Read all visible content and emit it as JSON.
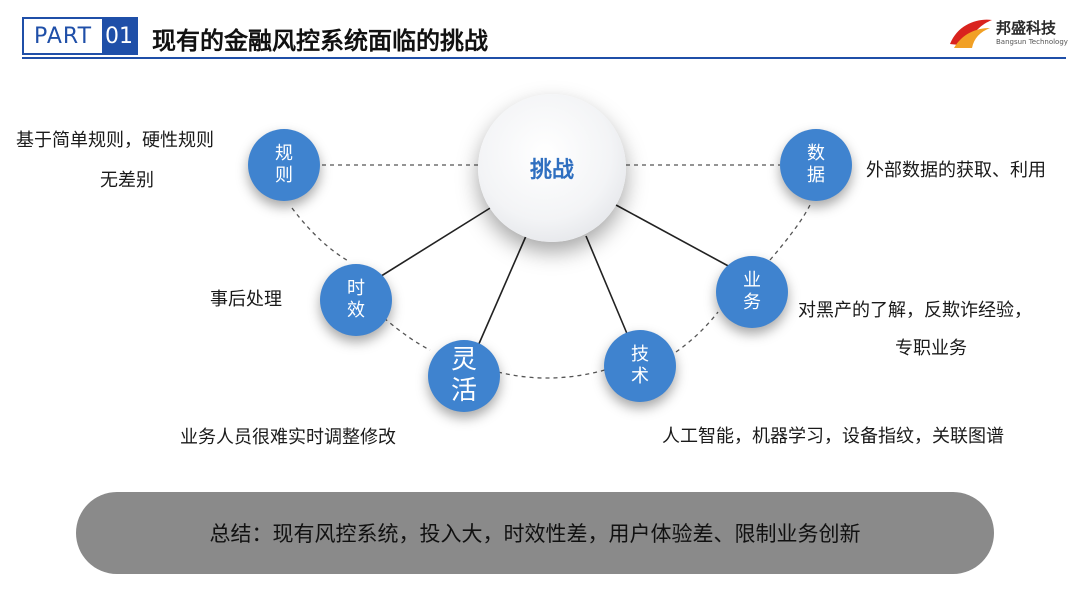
{
  "header": {
    "part_label": "PART",
    "part_number": "01",
    "title": "现有的金融风控系统面临的挑战",
    "logo_name": "邦盛科技",
    "logo_subtitle": "Bangsun Technology"
  },
  "diagram": {
    "center": "挑战",
    "nodes": {
      "rules": "规则",
      "timeliness": "时效",
      "flexible": "灵活",
      "tech": "技术",
      "business": "业务",
      "data": "数据"
    },
    "notes": {
      "rules_1": "基于简单规则，硬性规则",
      "rules_2": "无差别",
      "timeliness": "事后处理",
      "flexible": "业务人员很难实时调整修改",
      "tech": "人工智能，机器学习，设备指纹，关联图谱",
      "business_1": "对黑产的了解，反欺诈经验，",
      "business_2": "专职业务",
      "data": "外部数据的获取、利用"
    }
  },
  "summary": "总结：现有风控系统，投入大，时效性差，用户体验差、限制业务创新",
  "colors": {
    "brand_blue": "#1f4fa8",
    "node_blue": "#3f83cf",
    "center_text": "#2f6fc0",
    "summary_bg": "#8a8a8a"
  }
}
